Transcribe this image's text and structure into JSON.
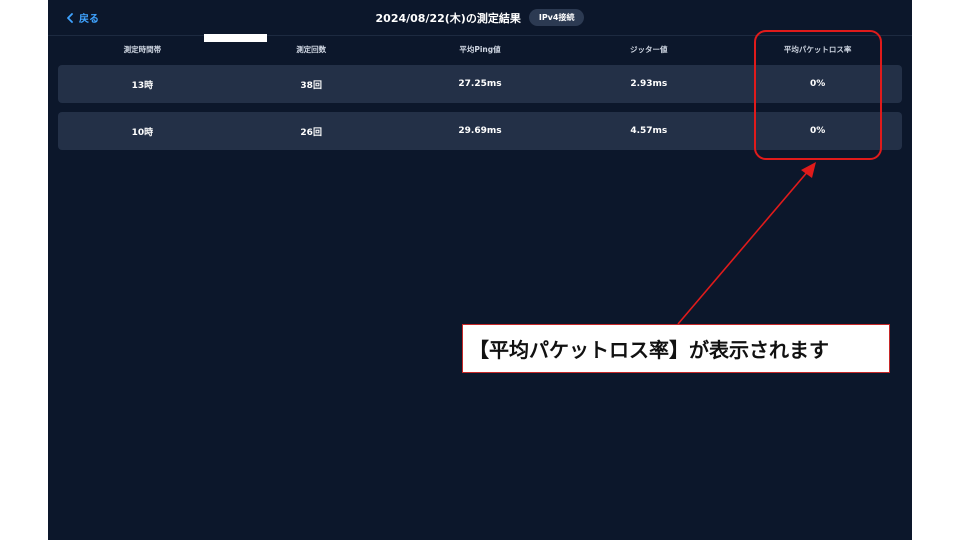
{
  "header": {
    "back_label": "戻る",
    "title": "2024/08/22(木)の測定結果",
    "badge": "IPv4接続"
  },
  "columns": [
    "測定時間帯",
    "測定回数",
    "平均Ping値",
    "ジッター値",
    "平均パケットロス率"
  ],
  "rows": [
    [
      "13時",
      "38回",
      "27.25ms",
      "2.93ms",
      "0%"
    ],
    [
      "10時",
      "26回",
      "29.69ms",
      "4.57ms",
      "0%"
    ]
  ],
  "annotation": {
    "text": "【平均パケットロス率】が表示されます",
    "color": "#e01b1b"
  }
}
